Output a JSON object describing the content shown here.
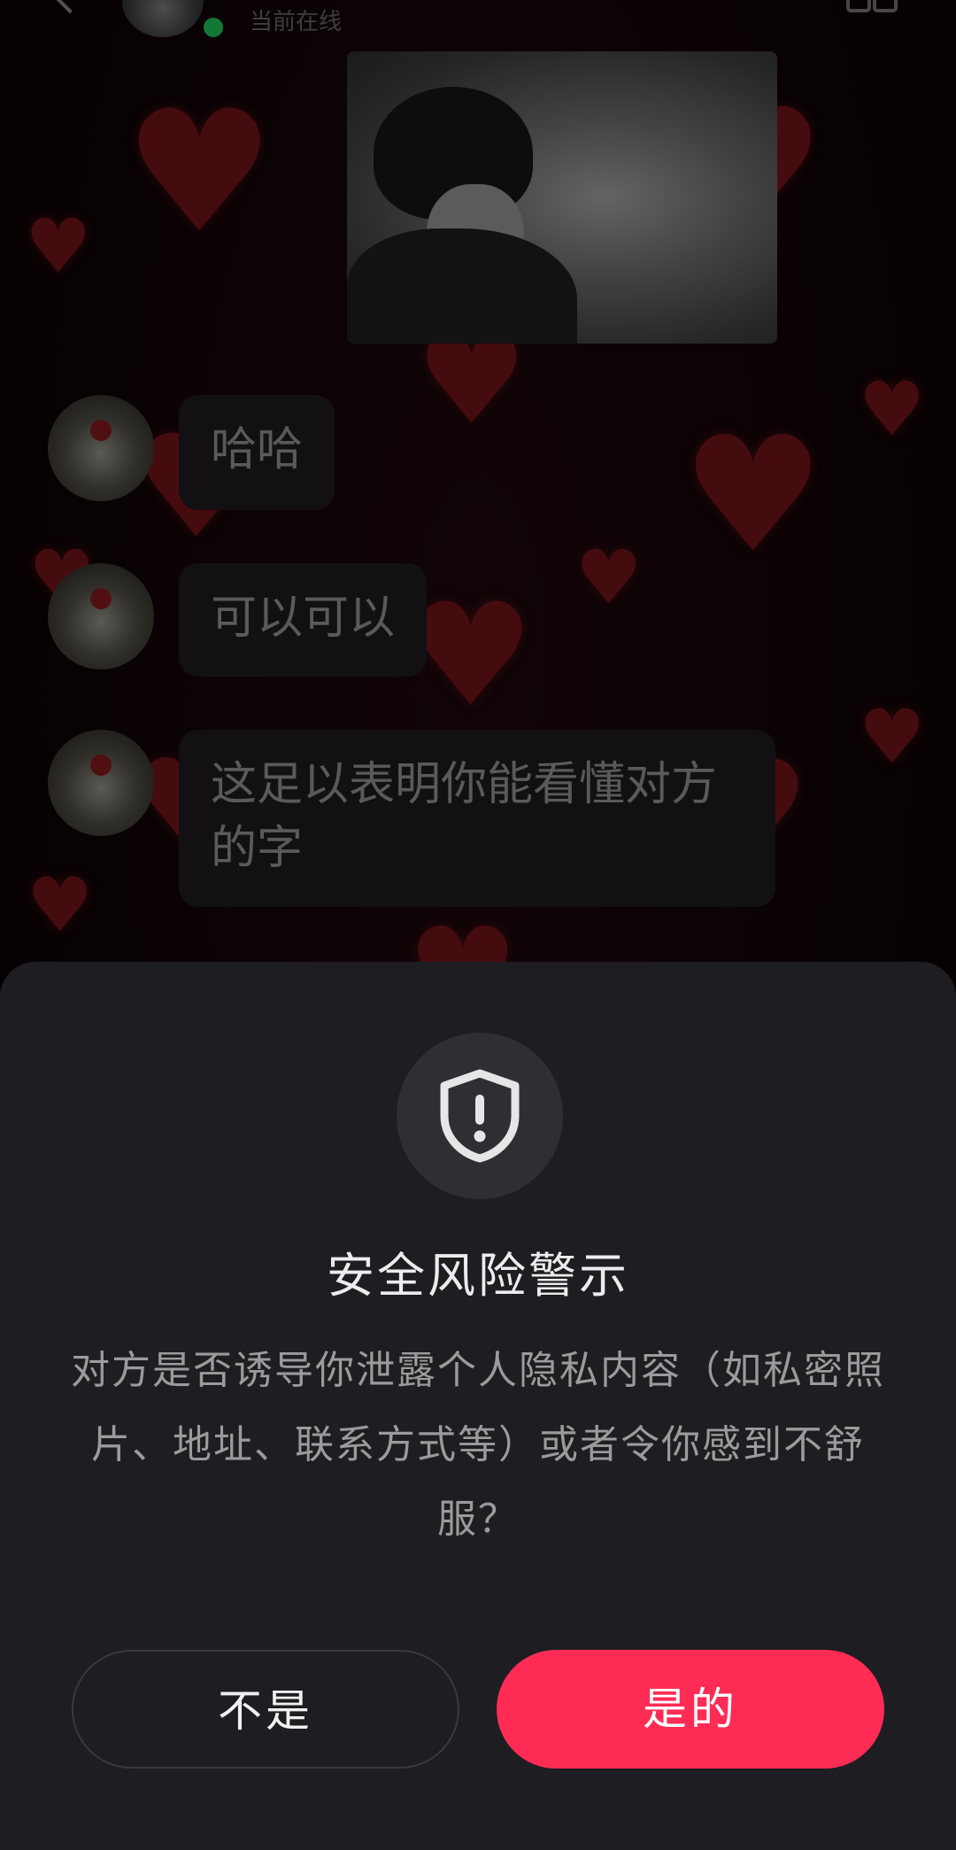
{
  "header": {
    "status_text": "当前在线"
  },
  "messages": [
    {
      "text": "哈哈"
    },
    {
      "text": "可以可以"
    },
    {
      "text": "这足以表明你能看懂对方的字"
    }
  ],
  "dialog": {
    "icon": "shield-exclamation-icon",
    "title": "安全风险警示",
    "body": "对方是否诱导你泄露个人隐私内容（如私密照片、地址、联系方式等）或者令你感到不舒服？",
    "no_label": "不是",
    "yes_label": "是的"
  },
  "colors": {
    "accent": "#fe2c55",
    "sheet_bg": "#1e1d22",
    "online_dot": "#1db954"
  }
}
